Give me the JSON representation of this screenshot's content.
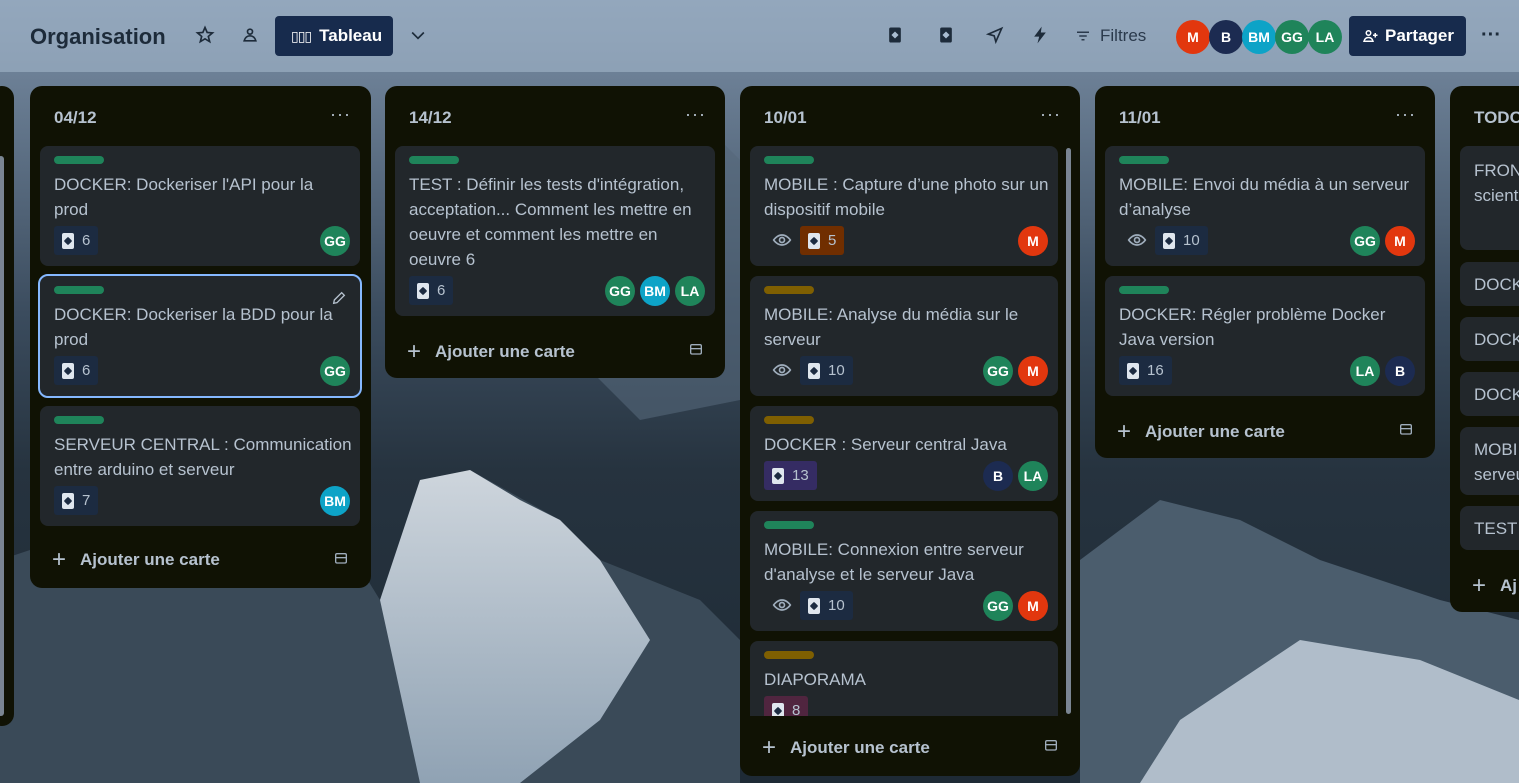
{
  "board": {
    "title": "Organisation",
    "view_label": "Tableau"
  },
  "header": {
    "filters_label": "Filtres",
    "share_label": "Partager",
    "members": [
      {
        "initials": "M",
        "color": "#e2370e"
      },
      {
        "initials": "B",
        "color": "#1c2b51"
      },
      {
        "initials": "BM",
        "color": "#0da3c7"
      },
      {
        "initials": "GG",
        "color": "#1f845a"
      },
      {
        "initials": "LA",
        "color": "#1f845a"
      }
    ]
  },
  "colors": {
    "label_green": "#1f845a",
    "label_yellow": "#7f5f01",
    "badge_blue": "#1c2b41",
    "badge_orange": "#702e00",
    "badge_purple": "#352c63",
    "badge_pink": "#50253f"
  },
  "lists": [
    {
      "title": "04/12",
      "add_label": "Ajouter une carte",
      "cards": [
        {
          "text": "DOCKER: Dockeriser l'API pour la prod",
          "badge": "6",
          "members": [
            "GG"
          ]
        },
        {
          "text": "DOCKER: Dockeriser la BDD pour la prod",
          "badge": "6",
          "members": [
            "GG"
          ]
        },
        {
          "text": "SERVEUR CENTRAL : Communication entre arduino et serveur",
          "badge": "7",
          "members": [
            "BM"
          ]
        }
      ]
    },
    {
      "title": "14/12",
      "add_label": "Ajouter une carte",
      "cards": [
        {
          "text": "TEST : Définir les tests d'intégration, acceptation... Comment les mettre en oeuvre et comment les mettre en oeuvre 6",
          "badge": "6",
          "members": [
            "GG",
            "BM",
            "LA"
          ]
        }
      ]
    },
    {
      "title": "10/01",
      "add_label": "Ajouter une carte",
      "cards": [
        {
          "text": "MOBILE : Capture d’une photo sur un dispositif mobile",
          "badge": "5",
          "members": [
            "M"
          ]
        },
        {
          "text": "MOBILE: Analyse du média sur le serveur",
          "badge": "10",
          "members": [
            "GG",
            "M"
          ]
        },
        {
          "text": "DOCKER : Serveur central Java",
          "badge": "13",
          "members": [
            "B",
            "LA"
          ]
        },
        {
          "text": "MOBILE: Connexion entre serveur d'analyse et le serveur Java",
          "badge": "10",
          "members": [
            "GG",
            "M"
          ]
        },
        {
          "text": "DIAPORAMA",
          "badge": "8",
          "members": []
        }
      ]
    },
    {
      "title": "11/01",
      "add_label": "Ajouter une carte",
      "cards": [
        {
          "text": "MOBILE: Envoi du média à un serveur d’analyse",
          "badge": "10",
          "members": [
            "GG",
            "M"
          ]
        },
        {
          "text": "DOCKER: Régler problème Docker Java version",
          "badge": "16",
          "members": [
            "LA",
            "B"
          ]
        }
      ]
    },
    {
      "title": "TODO",
      "add_label": "Aj",
      "cards": [
        {
          "text": "FRONT scient"
        },
        {
          "text": "DOCK"
        },
        {
          "text": "DOCK"
        },
        {
          "text": "DOCK"
        },
        {
          "text": "MOBI serveu"
        },
        {
          "text": "TEST"
        }
      ]
    }
  ]
}
